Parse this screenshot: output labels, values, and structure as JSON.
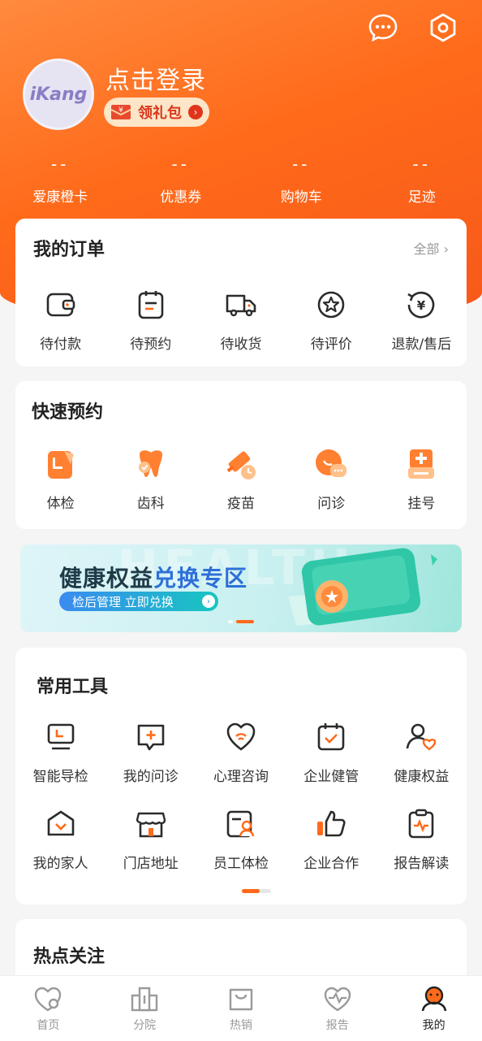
{
  "header": {
    "login_text": "点击登录",
    "avatar_logo": "iKang",
    "gift_label": "领礼包",
    "gift_symbol": "¥",
    "icons": [
      "message-icon",
      "settings-icon"
    ]
  },
  "stats": [
    {
      "value": "--",
      "label": "爱康橙卡"
    },
    {
      "value": "--",
      "label": "优惠券"
    },
    {
      "value": "--",
      "label": "购物车"
    },
    {
      "value": "--",
      "label": "足迹"
    }
  ],
  "orders": {
    "title": "我的订单",
    "all_label": "全部",
    "items": [
      {
        "label": "待付款",
        "icon": "wallet-icon"
      },
      {
        "label": "待预约",
        "icon": "clipboard-icon"
      },
      {
        "label": "待收货",
        "icon": "truck-icon"
      },
      {
        "label": "待评价",
        "icon": "star-badge-icon"
      },
      {
        "label": "退款/售后",
        "icon": "refund-icon"
      }
    ]
  },
  "quick": {
    "title": "快速预约",
    "items": [
      {
        "label": "体检",
        "icon": "checkup-icon"
      },
      {
        "label": "齿科",
        "icon": "tooth-icon"
      },
      {
        "label": "疫苗",
        "icon": "vaccine-icon"
      },
      {
        "label": "问诊",
        "icon": "chat-consult-icon"
      },
      {
        "label": "挂号",
        "icon": "register-icon"
      }
    ]
  },
  "banner": {
    "title_part1": "健康权益",
    "title_part2": "兑换专区",
    "pill_text": "检后管理 立即兑换",
    "bg_text": "HEALTH"
  },
  "tools": {
    "title": "常用工具",
    "row1": [
      {
        "label": "智能导检",
        "icon": "monitor-guide-icon"
      },
      {
        "label": "我的问诊",
        "icon": "message-plus-icon"
      },
      {
        "label": "心理咨询",
        "icon": "heart-wifi-icon"
      },
      {
        "label": "企业健管",
        "icon": "calendar-check-icon"
      },
      {
        "label": "健康权益",
        "icon": "user-heart-icon"
      }
    ],
    "row2": [
      {
        "label": "我的家人",
        "icon": "home-heart-icon"
      },
      {
        "label": "门店地址",
        "icon": "store-icon"
      },
      {
        "label": "员工体检",
        "icon": "id-card-icon"
      },
      {
        "label": "企业合作",
        "icon": "thumbs-up-icon"
      },
      {
        "label": "报告解读",
        "icon": "report-pulse-icon"
      }
    ]
  },
  "hot": {
    "title": "热点关注"
  },
  "tabbar": [
    {
      "label": "首页",
      "icon": "home-heart-tab-icon"
    },
    {
      "label": "分院",
      "icon": "building-tab-icon"
    },
    {
      "label": "热销",
      "icon": "bag-tab-icon"
    },
    {
      "label": "报告",
      "icon": "pulse-tab-icon"
    },
    {
      "label": "我的",
      "icon": "profile-tab-icon"
    }
  ],
  "colors": {
    "accent": "#ff6a1a",
    "hero": "#ff7a2a",
    "dark_icon": "#2b2b2b"
  }
}
